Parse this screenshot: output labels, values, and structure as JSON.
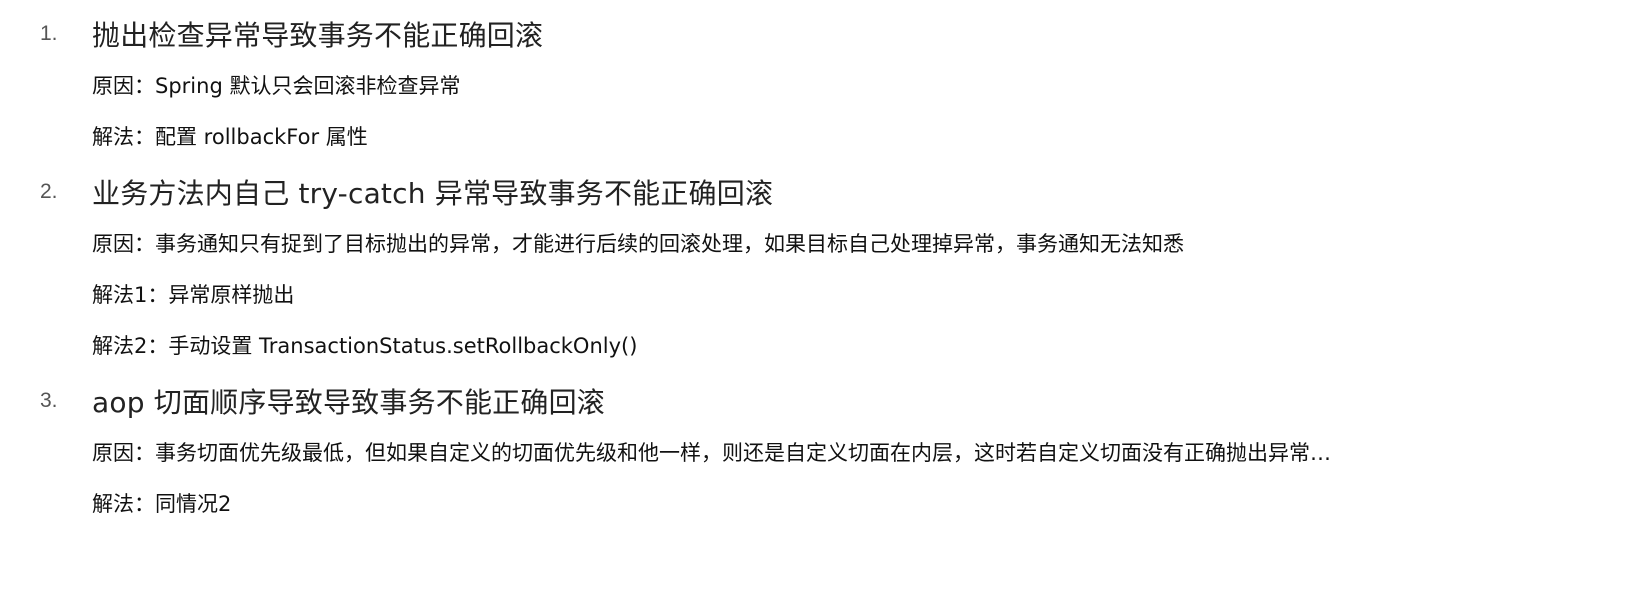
{
  "items": [
    {
      "number": "1.",
      "title": "抛出检查异常导致事务不能正确回滚",
      "details": [
        "原因：Spring 默认只会回滚非检查异常",
        "解法：配置 rollbackFor 属性"
      ]
    },
    {
      "number": "2.",
      "title": "业务方法内自己 try-catch 异常导致事务不能正确回滚",
      "details": [
        "原因：事务通知只有捉到了目标抛出的异常，才能进行后续的回滚处理，如果目标自己处理掉异常，事务通知无法知悉",
        "解法1：异常原样抛出",
        "解法2：手动设置 TransactionStatus.setRollbackOnly()"
      ]
    },
    {
      "number": "3.",
      "title": "aop 切面顺序导致导致事务不能正确回滚",
      "details": [
        "原因：事务切面优先级最低，但如果自定义的切面优先级和他一样，则还是自定义切面在内层，这时若自定义切面没有正确抛出异常…",
        "解法：同情况2"
      ]
    }
  ]
}
